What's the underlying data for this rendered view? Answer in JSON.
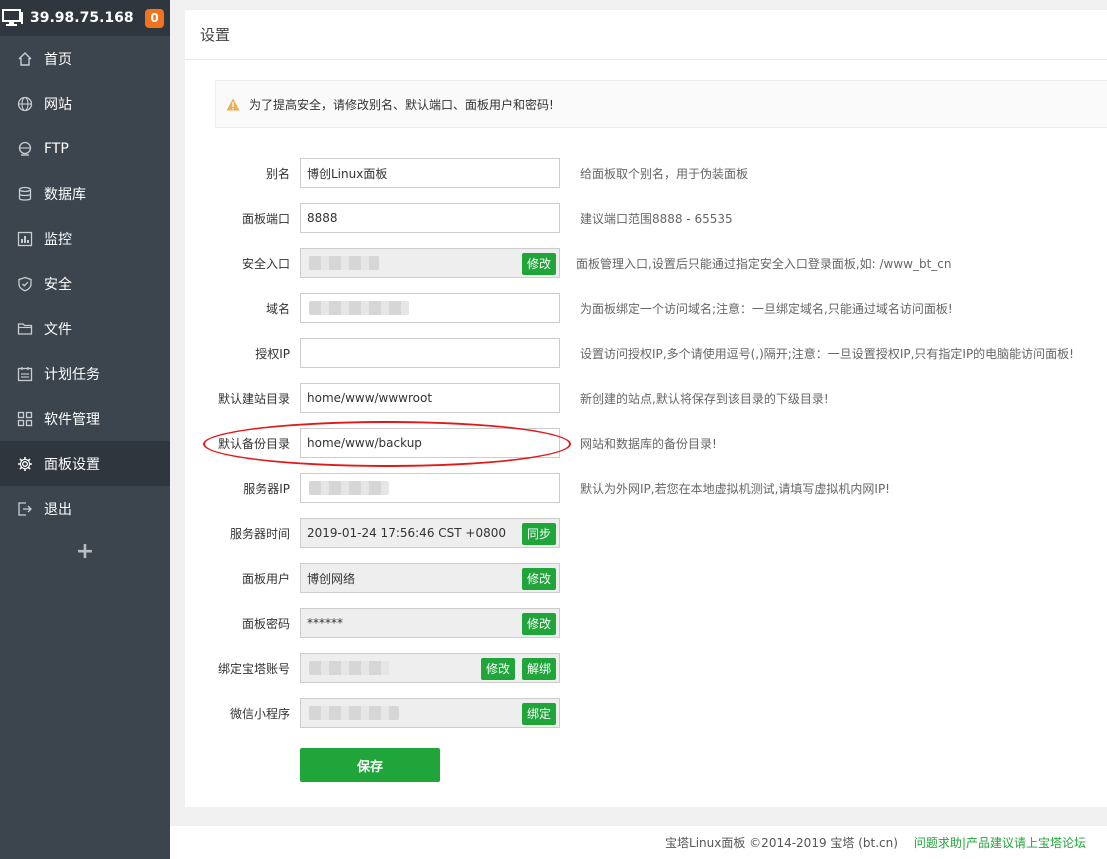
{
  "sidebar": {
    "server_ip": "39.98.75.168",
    "badge_count": "0",
    "items": [
      {
        "label": "首页",
        "icon": "home-icon"
      },
      {
        "label": "网站",
        "icon": "globe-icon"
      },
      {
        "label": "FTP",
        "icon": "ftp-icon"
      },
      {
        "label": "数据库",
        "icon": "database-icon"
      },
      {
        "label": "监控",
        "icon": "monitor-chart-icon"
      },
      {
        "label": "安全",
        "icon": "shield-icon"
      },
      {
        "label": "文件",
        "icon": "folder-icon"
      },
      {
        "label": "计划任务",
        "icon": "calendar-icon"
      },
      {
        "label": "软件管理",
        "icon": "grid-icon"
      },
      {
        "label": "面板设置",
        "icon": "gear-icon",
        "active": true
      },
      {
        "label": "退出",
        "icon": "logout-icon"
      }
    ],
    "add_label": "+"
  },
  "panel": {
    "title": "设置",
    "alert": "为了提高安全，请修改别名、默认端口、面板用户和密码!",
    "fields": {
      "alias": {
        "label": "别名",
        "value": "博创Linux面板",
        "tip": "给面板取个别名，用于伪装面板"
      },
      "port": {
        "label": "面板端口",
        "value": "8888",
        "tip": "建议端口范围8888 - 65535"
      },
      "entry": {
        "label": "安全入口",
        "button": "修改",
        "tip": "面板管理入口,设置后只能通过指定安全入口登录面板,如: /www_bt_cn"
      },
      "domain": {
        "label": "域名",
        "tip": "为面板绑定一个访问域名;注意：一旦绑定域名,只能通过域名访问面板!"
      },
      "auth_ip": {
        "label": "授权IP",
        "value": "",
        "tip": "设置访问授权IP,多个请使用逗号(,)隔开;注意：一旦设置授权IP,只有指定IP的电脑能访问面板!"
      },
      "site_dir": {
        "label": "默认建站目录",
        "value": "home/www/wwwroot",
        "tip": "新创建的站点,默认将保存到该目录的下级目录!"
      },
      "backup_dir": {
        "label": "默认备份目录",
        "value": "home/www/backup",
        "tip": "网站和数据库的备份目录!"
      },
      "server_ip": {
        "label": "服务器IP",
        "tip": "默认为外网IP,若您在本地虚拟机测试,请填写虚拟机内网IP!"
      },
      "server_time": {
        "label": "服务器时间",
        "value": "2019-01-24 17:56:46 CST +0800",
        "button": "同步"
      },
      "panel_user": {
        "label": "面板用户",
        "value": "博创网络",
        "button": "修改"
      },
      "panel_pass": {
        "label": "面板密码",
        "value": "******",
        "button": "修改"
      },
      "bt_account": {
        "label": "绑定宝塔账号",
        "button_edit": "修改",
        "button_unbind": "解绑"
      },
      "wechat": {
        "label": "微信小程序",
        "button": "绑定"
      }
    },
    "save_label": "保存"
  },
  "footer": {
    "copyright": "宝塔Linux面板 ©2014-2019 宝塔 (bt.cn)",
    "help_link": "问题求助",
    "separator": "|",
    "forum_link": "产品建议请上宝塔论坛"
  }
}
